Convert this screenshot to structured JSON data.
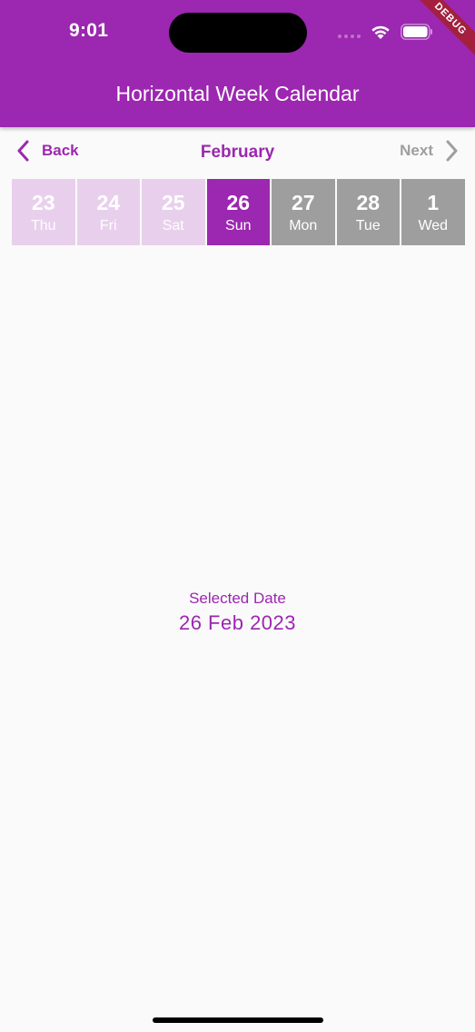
{
  "status_bar": {
    "time": "9:01"
  },
  "debug_banner": "DEBUG",
  "app_bar": {
    "title": "Horizontal Week Calendar"
  },
  "calendar_nav": {
    "back_label": "Back",
    "month": "February",
    "next_label": "Next"
  },
  "days": [
    {
      "date": "23",
      "weekday": "Thu",
      "state": "past"
    },
    {
      "date": "24",
      "weekday": "Fri",
      "state": "past"
    },
    {
      "date": "25",
      "weekday": "Sat",
      "state": "past"
    },
    {
      "date": "26",
      "weekday": "Sun",
      "state": "selected"
    },
    {
      "date": "27",
      "weekday": "Mon",
      "state": "future"
    },
    {
      "date": "28",
      "weekday": "Tue",
      "state": "future"
    },
    {
      "date": "1",
      "weekday": "Wed",
      "state": "future"
    }
  ],
  "selection": {
    "label": "Selected Date",
    "value": "26 Feb 2023"
  },
  "colors": {
    "primary": "#9c27b0",
    "past_day": "#e8d0ec",
    "future_day": "#9e9e9e",
    "disabled_nav": "#9e9e9e"
  }
}
